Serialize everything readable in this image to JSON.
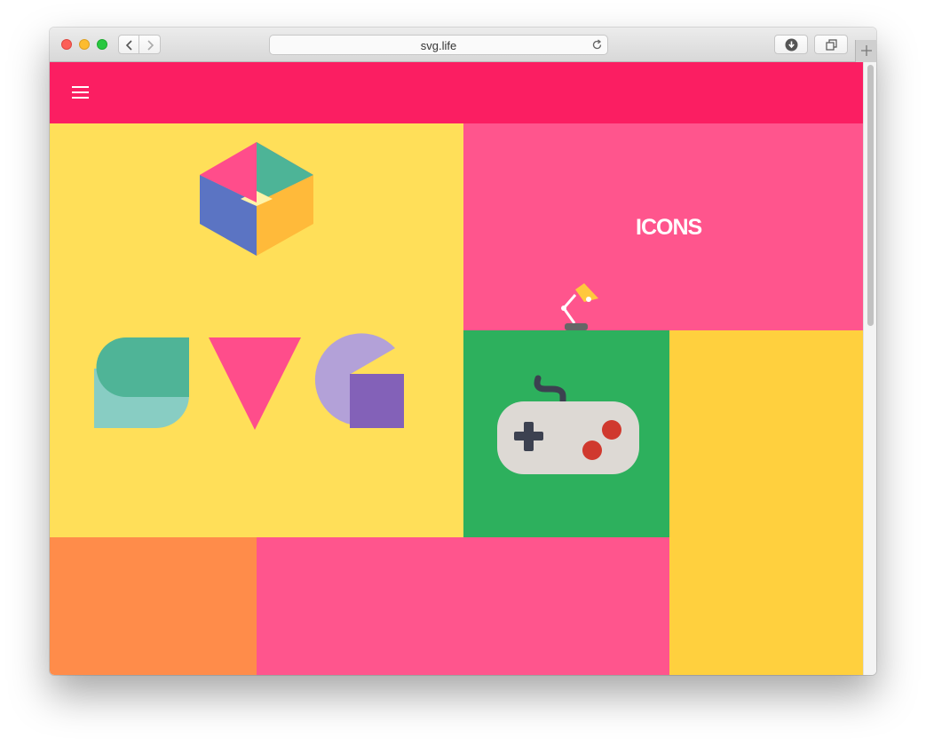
{
  "browser": {
    "url": "svg.life",
    "back_icon": "chevron-left-icon",
    "forward_icon": "chevron-right-icon",
    "reload_icon": "reload-icon",
    "download_icon": "download-icon",
    "tabs_icon": "show-tabs-icon",
    "new_tab_icon": "plus-icon"
  },
  "site": {
    "menu_icon": "hamburger-menu-icon",
    "colors": {
      "header": "#fb1e62",
      "svg_tile": "#ffdf59",
      "icons_tile": "#ff558d",
      "game_tile": "#2db05d",
      "yellow_tile": "#ffd03e",
      "orange_tile": "#ff8c4a",
      "pink_tile": "#ff558d"
    },
    "tiles": {
      "svg_logo": {
        "icon": "svg-logo-shapes-icon"
      },
      "icons": {
        "label": "ICONS",
        "icon": "desk-lamp-icon"
      },
      "game": {
        "icon": "gamepad-icon"
      }
    }
  }
}
